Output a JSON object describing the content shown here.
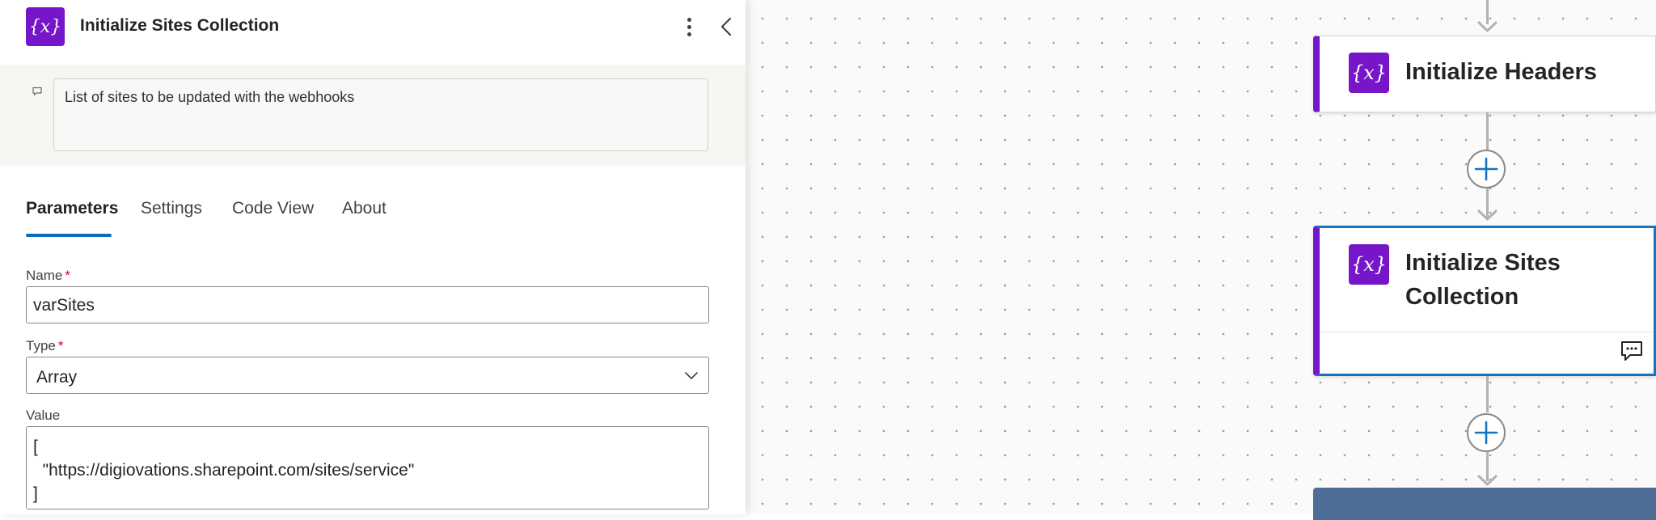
{
  "panel": {
    "title": "Initialize Sites Collection",
    "icon": "variable-icon",
    "comment": "List of sites to be updated with the webhooks",
    "tabs": [
      "Parameters",
      "Settings",
      "Code View",
      "About"
    ],
    "active_tab": "Parameters",
    "fields": {
      "name": {
        "label": "Name",
        "required_mark": "*",
        "value": "varSites"
      },
      "type": {
        "label": "Type",
        "required_mark": "*",
        "value": "Array"
      },
      "value": {
        "label": "Value",
        "lines": [
          "[",
          "  \"https://digiovations.sharepoint.com/sites/service\"",
          "]"
        ]
      }
    }
  },
  "canvas": {
    "cards": [
      {
        "title": "Initialize Headers",
        "icon": "variable-icon"
      },
      {
        "title_line1": "Initialize Sites",
        "title_line2": "Collection",
        "icon": "variable-icon",
        "selected": true
      }
    ]
  },
  "colors": {
    "accent": "#7716c9",
    "selection": "#1174c7",
    "tab_underline": "#0f6cbd",
    "required": "#c50f1f",
    "next_card": "#4e6e97"
  }
}
